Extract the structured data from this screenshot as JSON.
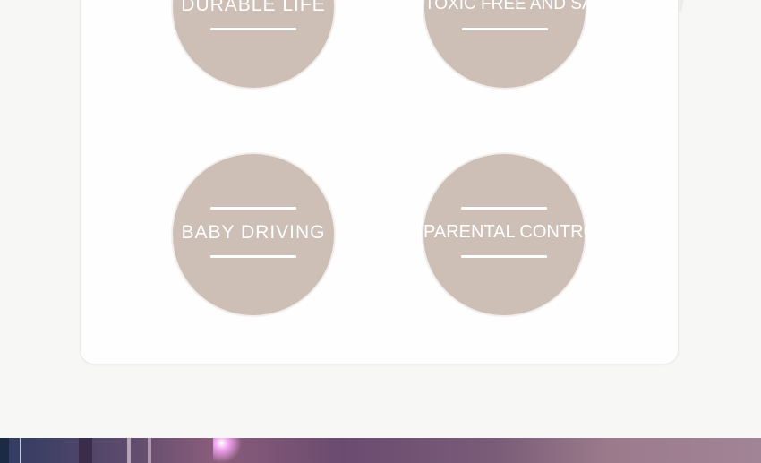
{
  "features": [
    {
      "label": "DURABLE LIFE"
    },
    {
      "label": "TOXIC FREE AND SAFE"
    },
    {
      "label": "BABY DRIVING"
    },
    {
      "label": "PARENTAL CONTROL"
    }
  ]
}
